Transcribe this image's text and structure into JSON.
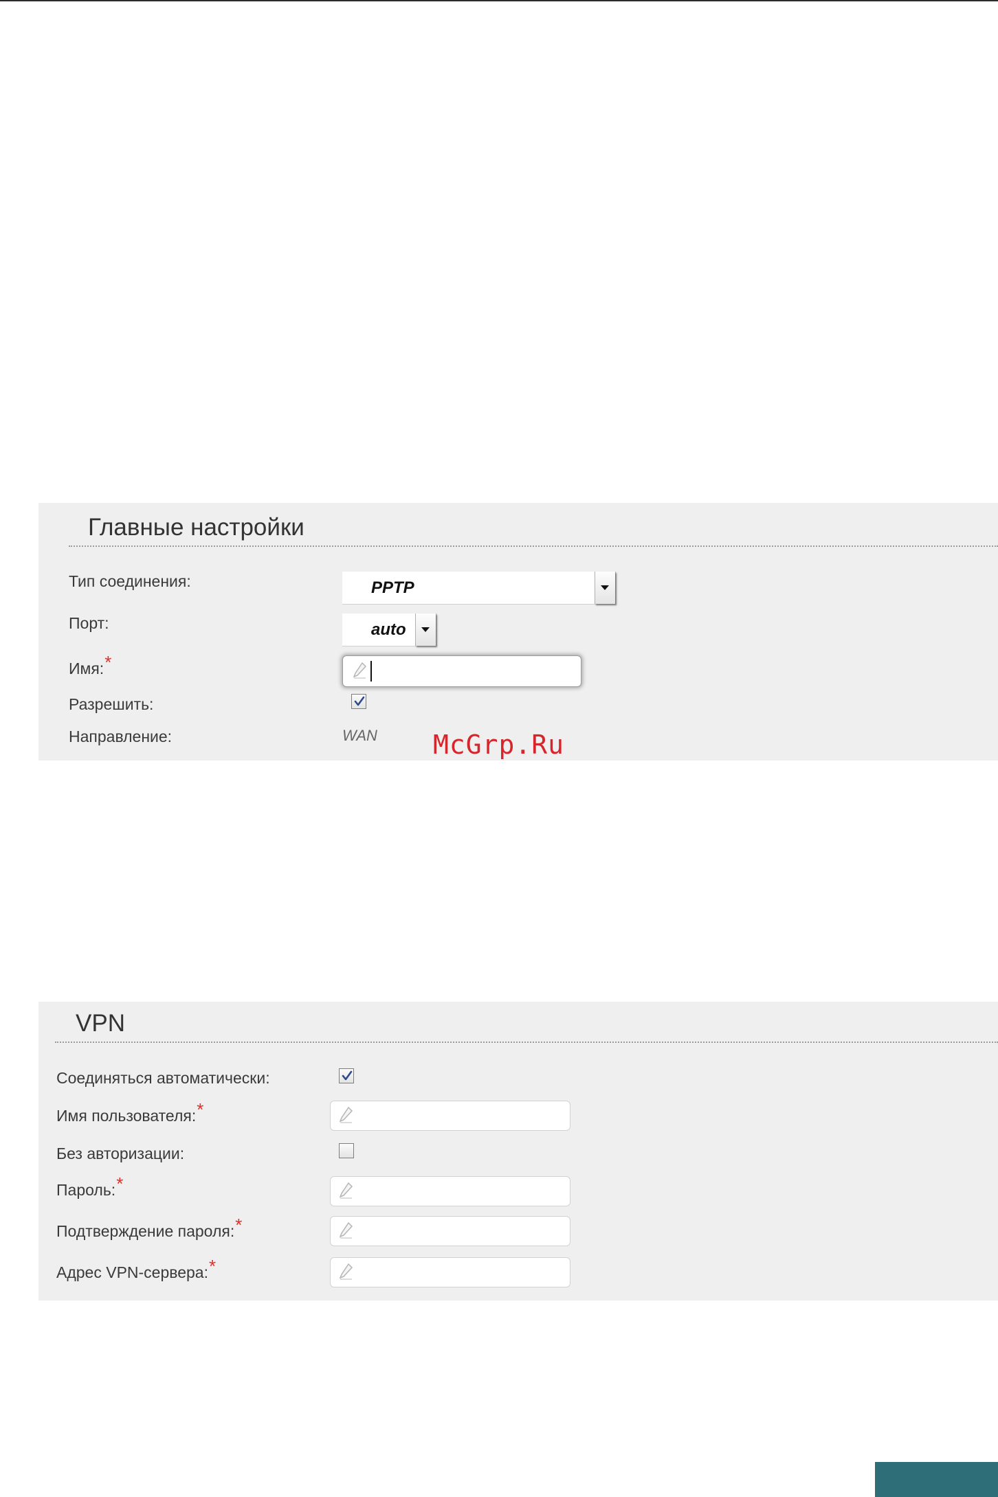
{
  "main_settings": {
    "title": "Главные настройки",
    "connection_type_label": "Тип соединения:",
    "connection_type_value": "PPTP",
    "port_label": "Порт:",
    "port_value": "auto",
    "name_label": "Имя:",
    "enable_label": "Разрешить:",
    "enable_checked": true,
    "direction_label": "Направление:",
    "direction_value": "WAN"
  },
  "vpn": {
    "title": "VPN",
    "auto_connect_label": "Соединяться автоматически:",
    "auto_connect_checked": true,
    "username_label": "Имя пользователя:",
    "no_auth_label": "Без авторизации:",
    "no_auth_checked": false,
    "password_label": "Пароль:",
    "password_confirm_label": "Подтверждение пароля:",
    "server_address_label": "Адрес VPN-сервера:"
  },
  "required_marker": "*",
  "watermark": "McGrp.Ru",
  "colors": {
    "panel_bg": "#efefef",
    "required": "#e0302a",
    "watermark": "#d7262b",
    "corner_accent": "#2d6e79"
  },
  "icons": {
    "input_icon": "pencil-icon",
    "select_icon": "chevron-down-icon",
    "checkbox_icon": "checkmark-icon"
  }
}
